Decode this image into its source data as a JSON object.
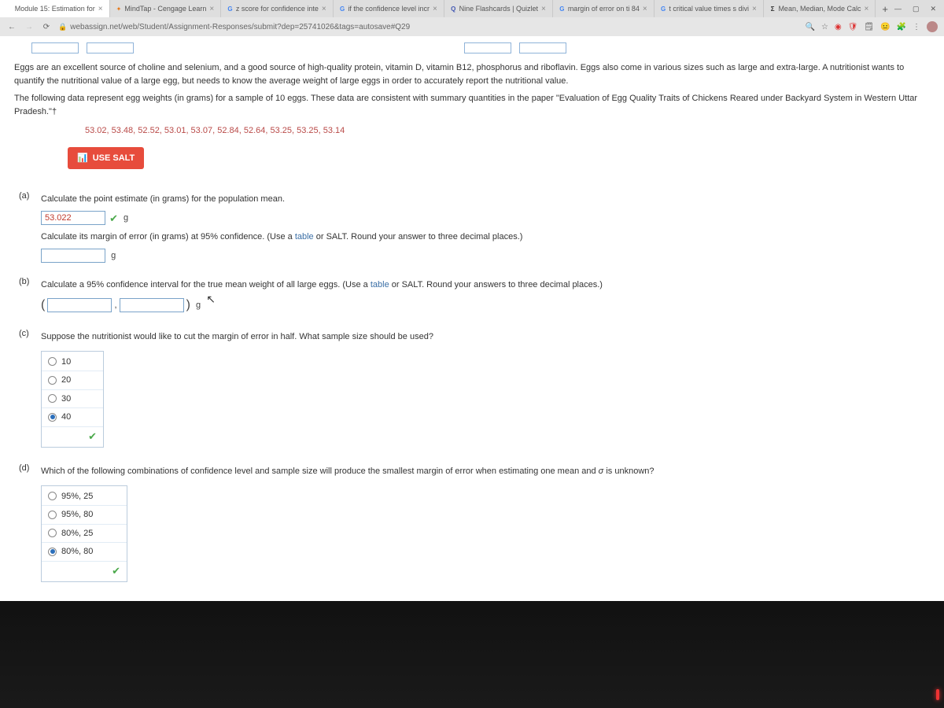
{
  "tabs": [
    {
      "title": "Module 15: Estimation for",
      "icon": ""
    },
    {
      "title": "MindTap - Cengage Learn",
      "icon": "m"
    },
    {
      "title": "z score for confidence inte",
      "icon": "g"
    },
    {
      "title": "if the confidence level incr",
      "icon": "g"
    },
    {
      "title": "Nine Flashcards | Quizlet",
      "icon": "q"
    },
    {
      "title": "margin of error on ti 84",
      "icon": "g"
    },
    {
      "title": "t critical value times s divi",
      "icon": "g"
    },
    {
      "title": "Mean, Median, Mode Calc",
      "icon": "s"
    }
  ],
  "url": "webassign.net/web/Student/Assignment-Responses/submit?dep=25741026&tags=autosave#Q29",
  "intro1": "Eggs are an excellent source of choline and selenium, and a good source of high-quality protein, vitamin D, vitamin B12, phosphorus and riboflavin. Eggs also come in various sizes such as large and extra-large. A nutritionist wants to quantify the nutritional value of a large egg, but needs to know the average weight of large eggs in order to accurately report the nutritional value.",
  "intro2a": "The following data represent egg weights (in grams) for a sample of 10 eggs. These data are consistent with summary quantities in the paper \"Evaluation of Egg Quality Traits of Chickens Reared under Backyard System in Western Uttar Pradesh.\"",
  "intro2b": "†",
  "data_line": "53.02, 53.48, 52.52, 53.01, 53.07, 52.84, 52.64, 53.25, 53.25, 53.14",
  "salt_label": "USE SALT",
  "parts": {
    "a": {
      "label": "(a)",
      "q1": "Calculate the point estimate (in grams) for the population mean.",
      "ans1": "53.022",
      "unit": "g",
      "q2_a": "Calculate its margin of error (in grams) at 95% confidence. (Use a ",
      "q2_link": "table",
      "q2_b": " or SALT. Round your answer to three decimal places.)"
    },
    "b": {
      "label": "(b)",
      "q_a": "Calculate a 95% confidence interval for the true mean weight of all large eggs. (Use a ",
      "q_link": "table",
      "q_b": " or SALT. Round your answers to three decimal places.)",
      "unit": "g"
    },
    "c": {
      "label": "(c)",
      "q": "Suppose the nutritionist would like to cut the margin of error in half. What sample size should be used?",
      "options": [
        "10",
        "20",
        "30",
        "40"
      ],
      "selected": 3
    },
    "d": {
      "label": "(d)",
      "q_a": "Which of the following combinations of confidence level and sample size will produce the smallest margin of error when estimating one mean and ",
      "sigma": "σ",
      "q_b": " is unknown?",
      "options": [
        "95%, 25",
        "95%, 80",
        "80%, 25",
        "80%, 80"
      ],
      "selected": 3
    }
  },
  "icons": {
    "plus": "+",
    "min": "—",
    "max": "▢",
    "close": "✕",
    "back": "←",
    "fwd": "→",
    "reload": "⟳",
    "lock": "🔒",
    "zoom": "🔍",
    "star": "☆",
    "puzzle": "🧩",
    "shield": "🛡",
    "note": "🗒",
    "face": "😐",
    "vert": "⋮",
    "salt": "📊",
    "check": "✔",
    "cursor": "↖"
  }
}
